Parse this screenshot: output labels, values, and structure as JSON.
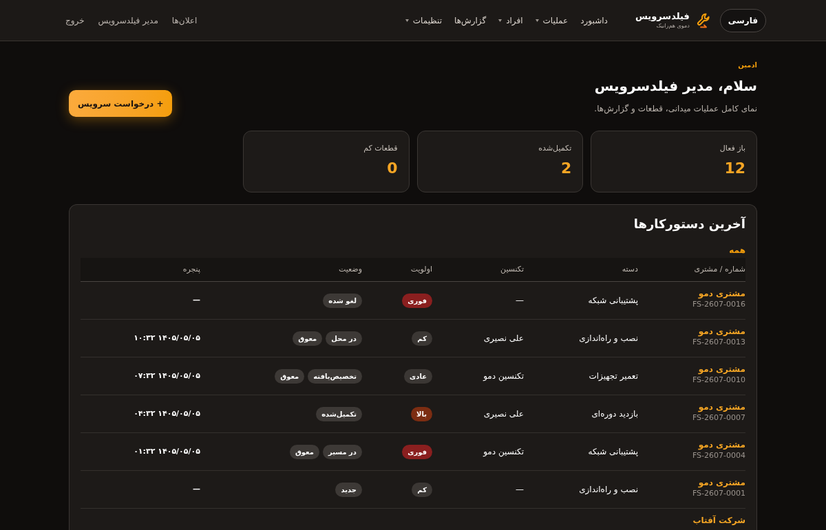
{
  "header": {
    "language_button": "فارسی",
    "brand": {
      "name": "فیلدسرویس",
      "tagline": "دموی هم‌رانیک"
    },
    "nav": [
      {
        "label": "داشبورد",
        "has_menu": false
      },
      {
        "label": "عملیات",
        "has_menu": true
      },
      {
        "label": "افراد",
        "has_menu": true
      },
      {
        "label": "گزارش‌ها",
        "has_menu": false
      },
      {
        "label": "تنظیمات",
        "has_menu": true
      }
    ],
    "user_links": [
      "اعلان‌ها",
      "مدیر فیلدسرویس",
      "خروج"
    ]
  },
  "intro": {
    "role": "ادمین",
    "title": "سلام، مدیر فیلدسرویس",
    "subtitle": "نمای کامل عملیات میدانی، قطعات و گزارش‌ها.",
    "action_button": "+ درخواست سرویس"
  },
  "stats": [
    {
      "label": "باز فعال",
      "value": "12"
    },
    {
      "label": "تکمیل‌شده",
      "value": "2"
    },
    {
      "label": "قطعات کم",
      "value": "0"
    }
  ],
  "work_orders": {
    "title": "آخرین دستورکارها",
    "filter_link": "همه",
    "columns": [
      "شماره / مشتری",
      "دسته",
      "تکنسین",
      "اولویت",
      "وضعیت",
      "پنجره"
    ],
    "rows": [
      {
        "customer": "مشتری دمو",
        "number": "FS-2607-0016",
        "category": "پشتیبانی شبکه",
        "technician": "—",
        "priority": {
          "label": "فوری",
          "color": "#8a1f1f"
        },
        "statuses": [
          "لغو شده"
        ],
        "window": "—"
      },
      {
        "customer": "مشتری دمو",
        "number": "FS-2607-0013",
        "category": "نصب و راه‌اندازی",
        "technician": "علی نصیری",
        "priority": {
          "label": "کم",
          "color": "#3b3734"
        },
        "statuses": [
          "در محل",
          "معوق"
        ],
        "window": "۱۴۰۵/۰۵/۰۵ ۱۰:۳۲"
      },
      {
        "customer": "مشتری دمو",
        "number": "FS-2607-0010",
        "category": "تعمیر تجهیزات",
        "technician": "تکنسین دمو",
        "priority": {
          "label": "عادی",
          "color": "#3b3734"
        },
        "statuses": [
          "تخصیص‌یافته",
          "معوق"
        ],
        "window": "۱۴۰۵/۰۵/۰۵ ۰۷:۳۲"
      },
      {
        "customer": "مشتری دمو",
        "number": "FS-2607-0007",
        "category": "بازدید دوره‌ای",
        "technician": "علی نصیری",
        "priority": {
          "label": "بالا",
          "color": "#7c2d12"
        },
        "statuses": [
          "تکمیل‌شده"
        ],
        "window": "۱۴۰۵/۰۵/۰۵ ۰۴:۳۲"
      },
      {
        "customer": "مشتری دمو",
        "number": "FS-2607-0004",
        "category": "پشتیبانی شبکه",
        "technician": "تکنسین دمو",
        "priority": {
          "label": "فوری",
          "color": "#8a1f1f"
        },
        "statuses": [
          "در مسیر",
          "معوق"
        ],
        "window": "۱۴۰۵/۰۵/۰۵ ۰۱:۳۲"
      },
      {
        "customer": "مشتری دمو",
        "number": "FS-2607-0001",
        "category": "نصب و راه‌اندازی",
        "technician": "—",
        "priority": {
          "label": "کم",
          "color": "#3b3734"
        },
        "statuses": [
          "جدید"
        ],
        "window": "—"
      },
      {
        "customer": "شرکت آفتاب"
      }
    ]
  }
}
